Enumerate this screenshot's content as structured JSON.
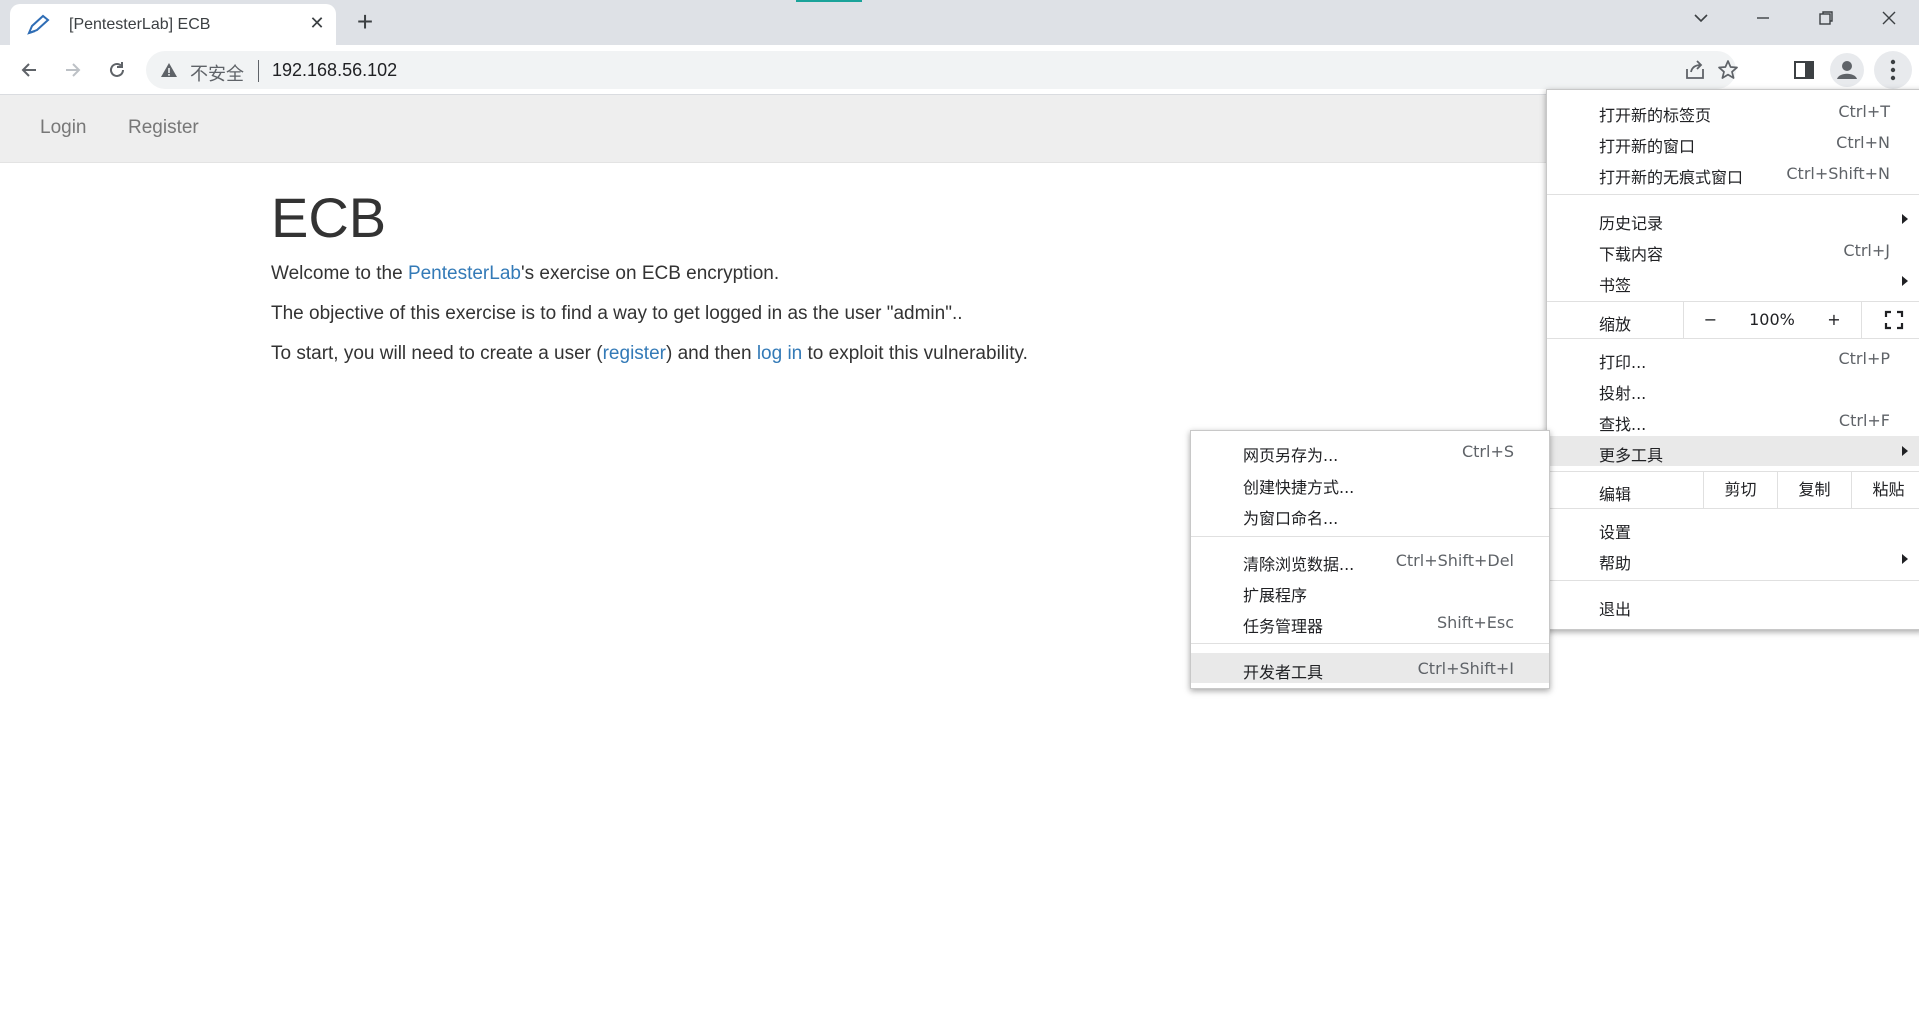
{
  "browser": {
    "tab_title": "[PentesterLab] ECB",
    "address_security": "不安全",
    "address_url": "192.168.56.102",
    "accent_color": "#1aa39a"
  },
  "page": {
    "nav": {
      "login": "Login",
      "register": "Register"
    },
    "heading": "ECB",
    "para1": {
      "before": "Welcome to the ",
      "link": "PentesterLab",
      "after": "'s exercise on ECB encryption."
    },
    "para2": "The objective of this exercise is to find a way to get logged in as the user \"admin\"..",
    "para3": {
      "before": "To start, you will need to create a user (",
      "link1": "register",
      "middle": ") and then ",
      "link2": "log in",
      "after": " to exploit this vulnerability."
    },
    "link_color": "#337ab7"
  },
  "main_menu": {
    "new_tab": {
      "label": "打开新的标签页",
      "shortcut": "Ctrl+T"
    },
    "new_window": {
      "label": "打开新的窗口",
      "shortcut": "Ctrl+N"
    },
    "new_incognito": {
      "label": "打开新的无痕式窗口",
      "shortcut": "Ctrl+Shift+N"
    },
    "history": {
      "label": "历史记录"
    },
    "downloads": {
      "label": "下载内容",
      "shortcut": "Ctrl+J"
    },
    "bookmarks": {
      "label": "书签"
    },
    "zoom": {
      "label": "缩放",
      "minus": "−",
      "value": "100%",
      "plus": "+"
    },
    "print": {
      "label": "打印...",
      "shortcut": "Ctrl+P"
    },
    "cast": {
      "label": "投射..."
    },
    "find": {
      "label": "查找...",
      "shortcut": "Ctrl+F"
    },
    "more_tools": {
      "label": "更多工具"
    },
    "edit": {
      "label": "编辑",
      "cut": "剪切",
      "copy": "复制",
      "paste": "粘贴"
    },
    "settings": {
      "label": "设置"
    },
    "help": {
      "label": "帮助"
    },
    "exit": {
      "label": "退出"
    }
  },
  "more_tools_menu": {
    "save_page": {
      "label": "网页另存为...",
      "shortcut": "Ctrl+S"
    },
    "create_shortcut": {
      "label": "创建快捷方式..."
    },
    "name_window": {
      "label": "为窗口命名..."
    },
    "clear_data": {
      "label": "清除浏览数据...",
      "shortcut": "Ctrl+Shift+Del"
    },
    "extensions": {
      "label": "扩展程序"
    },
    "task_manager": {
      "label": "任务管理器",
      "shortcut": "Shift+Esc"
    },
    "dev_tools": {
      "label": "开发者工具",
      "shortcut": "Ctrl+Shift+I"
    }
  }
}
